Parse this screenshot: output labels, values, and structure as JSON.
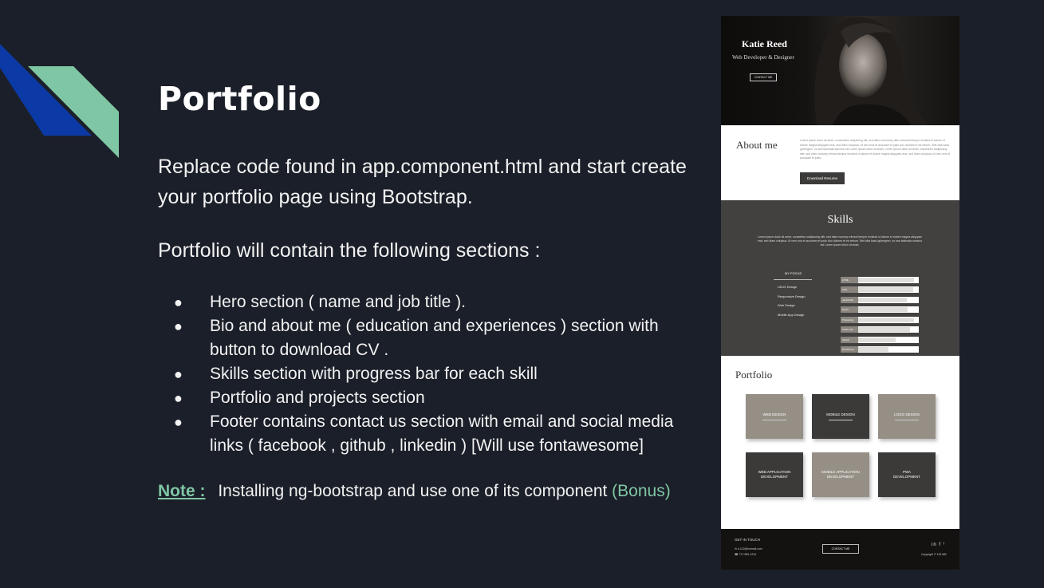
{
  "slide": {
    "title": "Portfolio",
    "intro": "Replace code found in app.component.html and start create your portfolio page using Bootstrap.",
    "sections_intro": "Portfolio will contain the following sections :",
    "bullets": [
      "Hero section ( name and job title ).",
      "Bio and about me ( education and experiences ) section with button to download CV .",
      "Skills section with progress bar for each skill",
      "Portfolio and projects section",
      "Footer contains contact us section with email and social media links ( facebook , github , linkedin ) [Will use fontawesome]"
    ],
    "bullet_glyph": "●",
    "note_label": "Note :",
    "note_text": "Installing ng-bootstrap and use one of its component",
    "note_bonus": "(Bonus)",
    "colors": {
      "background": "#1b1f29",
      "accent_green": "#7fc6a4",
      "accent_blue": "#0b3aa6"
    }
  },
  "mockup": {
    "hero": {
      "name": "Katie Reed",
      "title": "Web Developer & Designer",
      "button": "CONTACT ME"
    },
    "about": {
      "heading": "About me",
      "text": "Lorem ipsum dolor sit amet, consectetur adipiscing elit, sed diam nonummy nibh euismod tempor incidunt ut labore et dolore magna aliquyam erat, sed diam voluptua. At vero eos et accusam et justo duo dolores et ea rebum. Stet clita kasd gubergren, no sea takimata sanctus est Lorem ipsum dolor sit amet. Lorem ipsum dolor sit amet, consetetur sadipscing elitr, sed diam nonumy eirmod tempor invidunt ut labore et dolore magna aliquyam erat, sed diam voluptua. At vero eos et accusam et justo.",
      "button": "Download Resume"
    },
    "skills": {
      "heading": "Skills",
      "text": "Lorem ipsum dolor sit amet, consetetur sadipscing elitr, sed diam nonumy eirmod tempor invidunt ut labore et dolore magna aliquyam erat, sed diam voluptua. At vero eos et accusam et justo duo dolores et ea rebum. Stet clita kasd gubergren, no sea takimata sanctus est Lorem ipsum dolor sit amet.",
      "focus_label": "MY FOCUS",
      "focus_items": [
        "UI/UX Design",
        "Responsive Design",
        "Web Design",
        "Mobile App Design"
      ],
      "bars": [
        {
          "label": "HTML",
          "level": 0.95
        },
        {
          "label": "CSS",
          "level": 0.93
        },
        {
          "label": "JavaScript",
          "level": 0.82
        },
        {
          "label": "React",
          "level": 0.84
        },
        {
          "label": "Photoshop",
          "level": 0.95
        },
        {
          "label": "Adobe XD",
          "level": 0.88
        },
        {
          "label": "Sketch",
          "level": 0.64
        },
        {
          "label": "WordPress",
          "level": 0.51
        }
      ]
    },
    "portfolio": {
      "heading": "Portfolio",
      "tiles": [
        {
          "label": "WEB DESIGN",
          "tone": "light",
          "underline": true
        },
        {
          "label": "MOBILE DESIGN",
          "tone": "dark",
          "underline": true
        },
        {
          "label": "LOGO DESIGN",
          "tone": "light",
          "underline": true
        },
        {
          "label": "WEB APPLICATION\nDEVELOPMENT",
          "tone": "dark",
          "underline": false
        },
        {
          "label": "MOBILE APPLICATION\nDEVELOPMENT",
          "tone": "light",
          "underline": false
        },
        {
          "label": "PWA\nDEVELOPMENT",
          "tone": "dark",
          "underline": false
        }
      ]
    },
    "footer": {
      "heading": "GET IN TOUCH",
      "email": "k-112@hotmail.com",
      "phone": "717-555-1234",
      "button": "CONTACT ME",
      "social": "in f ᵗ",
      "copyright": "Copyright © 123 MB"
    }
  }
}
